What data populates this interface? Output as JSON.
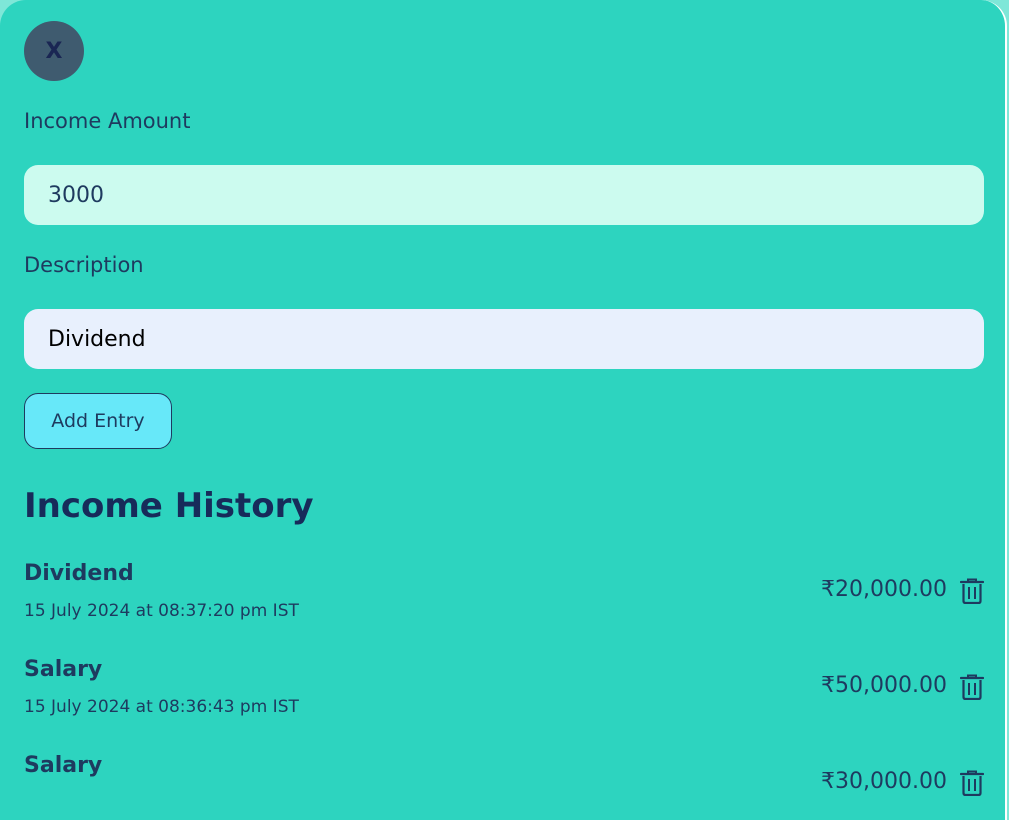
{
  "close_label": "X",
  "form": {
    "amount_label": "Income Amount",
    "amount_value": "3000",
    "description_label": "Description",
    "description_value": "Dividend",
    "add_button_label": "Add Entry"
  },
  "history": {
    "title": "Income History",
    "entries": [
      {
        "name": "Dividend",
        "date": "15 July 2024 at 08:37:20 pm IST",
        "amount": "₹20,000.00"
      },
      {
        "name": "Salary",
        "date": "15 July 2024 at 08:36:43 pm IST",
        "amount": "₹50,000.00"
      },
      {
        "name": "Salary",
        "date": "",
        "amount": "₹30,000.00"
      }
    ]
  },
  "colors": {
    "panel_bg": "#2dd4bf",
    "amount_input_bg": "#ccfbef",
    "description_input_bg": "#e8f0fd",
    "button_bg": "#67e8f9",
    "text": "#1e3a5f"
  },
  "icons": {
    "delete": "trash-icon"
  }
}
